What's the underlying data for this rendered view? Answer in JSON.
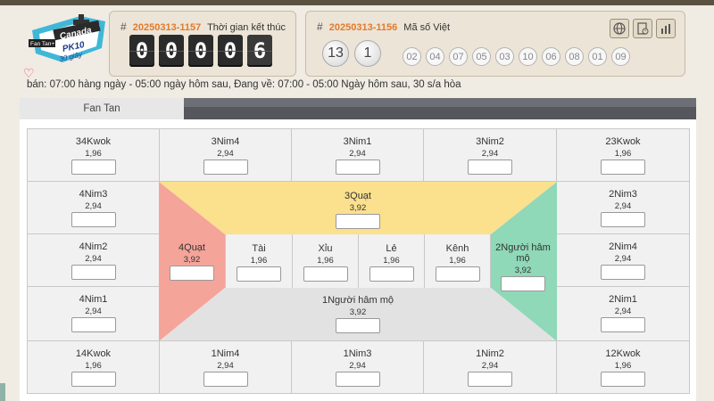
{
  "logo": {
    "brand": "Canada",
    "sub_tag": "Fan Tan+",
    "game": "PK10",
    "interval": "30 giây"
  },
  "panel_countdown": {
    "period": "20250313-1157",
    "label": "Thời gian kết thúc",
    "digits": [
      "0",
      "0",
      "0",
      "0",
      "6"
    ]
  },
  "panel_result": {
    "period": "20250313-1156",
    "label": "Mã số Việt",
    "big_balls": [
      "13",
      "1"
    ],
    "small_balls": [
      "02",
      "04",
      "07",
      "05",
      "03",
      "10",
      "06",
      "08",
      "01",
      "09"
    ]
  },
  "tools": {
    "icons": [
      "globe-icon",
      "report-icon",
      "chart-icon"
    ]
  },
  "infobar": {
    "text": "bán: 07:00 hàng ngày - 05:00 ngày hôm sau,   Đang về: 07:00 - 05:00 Ngày hôm sau, 30 s/a hòa"
  },
  "tabs": {
    "active": "Fan Tan"
  },
  "board": {
    "r1": [
      {
        "name": "34Kwok",
        "odds": "1,96"
      },
      {
        "name": "3Nim4",
        "odds": "2,94"
      },
      {
        "name": "3Nim1",
        "odds": "2,94"
      },
      {
        "name": "3Nim2",
        "odds": "2,94"
      },
      {
        "name": "23Kwok",
        "odds": "1,96"
      }
    ],
    "left": [
      {
        "name": "4Nim3",
        "odds": "2,94"
      },
      {
        "name": "4Nim2",
        "odds": "2,94"
      },
      {
        "name": "4Nim1",
        "odds": "2,94"
      }
    ],
    "right": [
      {
        "name": "2Nim3",
        "odds": "2,94"
      },
      {
        "name": "2Nim4",
        "odds": "2,94"
      },
      {
        "name": "2Nim1",
        "odds": "2,94"
      }
    ],
    "r5": [
      {
        "name": "14Kwok",
        "odds": "1,96"
      },
      {
        "name": "1Nim4",
        "odds": "2,94"
      },
      {
        "name": "1Nim3",
        "odds": "2,94"
      },
      {
        "name": "1Nim2",
        "odds": "2,94"
      },
      {
        "name": "12Kwok",
        "odds": "1,96"
      }
    ],
    "top_zone": {
      "name": "3Quạt",
      "odds": "3,92"
    },
    "left_zone": {
      "name": "4Quạt",
      "odds": "3,92"
    },
    "right_zone": {
      "name": "2Người hâm mộ",
      "odds": "3,92"
    },
    "bottom_zone": {
      "name": "1Người hâm mộ",
      "odds": "3,92"
    },
    "middle": [
      {
        "name": "Tài",
        "odds": "1,96"
      },
      {
        "name": "Xỉu",
        "odds": "1,96"
      },
      {
        "name": "Lẻ",
        "odds": "1,96"
      },
      {
        "name": "Kênh",
        "odds": "1,96"
      }
    ]
  },
  "colors": {
    "top_zone": "#fbe08e",
    "left_zone": "#f5a49a",
    "right_zone": "#8fd8b8",
    "bottom_zone": "#e2e2e2",
    "period": "#e27a2b"
  }
}
